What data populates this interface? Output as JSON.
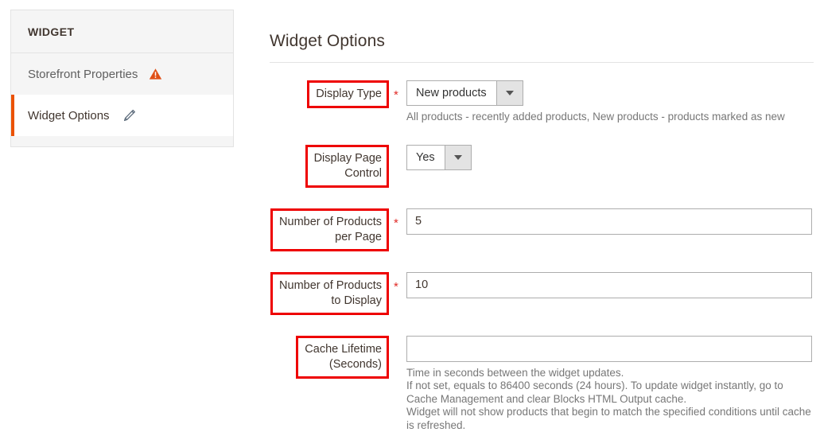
{
  "sidebar": {
    "header": "WIDGET",
    "items": [
      {
        "label": "Storefront Properties",
        "icon": "warning-icon",
        "active": false
      },
      {
        "label": "Widget Options",
        "icon": "pencil-icon",
        "active": true
      }
    ]
  },
  "main": {
    "title": "Widget Options",
    "required_marker": "*",
    "fields": {
      "display_type": {
        "label_line1": "Display Type",
        "value": "New products",
        "help": "All products - recently added products, New products - products marked as new"
      },
      "display_page_control": {
        "label_line1": "Display Page",
        "label_line2": "Control",
        "value": "Yes"
      },
      "products_per_page": {
        "label_line1": "Number of Products",
        "label_line2": "per Page",
        "value": "5"
      },
      "products_to_display": {
        "label_line1": "Number of Products",
        "label_line2": "to Display",
        "value": "10"
      },
      "cache_lifetime": {
        "label_line1": "Cache Lifetime",
        "label_line2": "(Seconds)",
        "value": "",
        "help_line1": "Time in seconds between the widget updates.",
        "help_line2": "If not set, equals to 86400 seconds (24 hours). To update widget instantly, go to Cache Management and clear Blocks HTML Output cache.",
        "help_line3": "Widget will not show products that begin to match the specified conditions until cache is refreshed."
      }
    }
  },
  "colors": {
    "accent": "#eb5202",
    "annotation": "#ee0000",
    "required": "#e02b27",
    "panel_bg": "#f5f5f5"
  }
}
